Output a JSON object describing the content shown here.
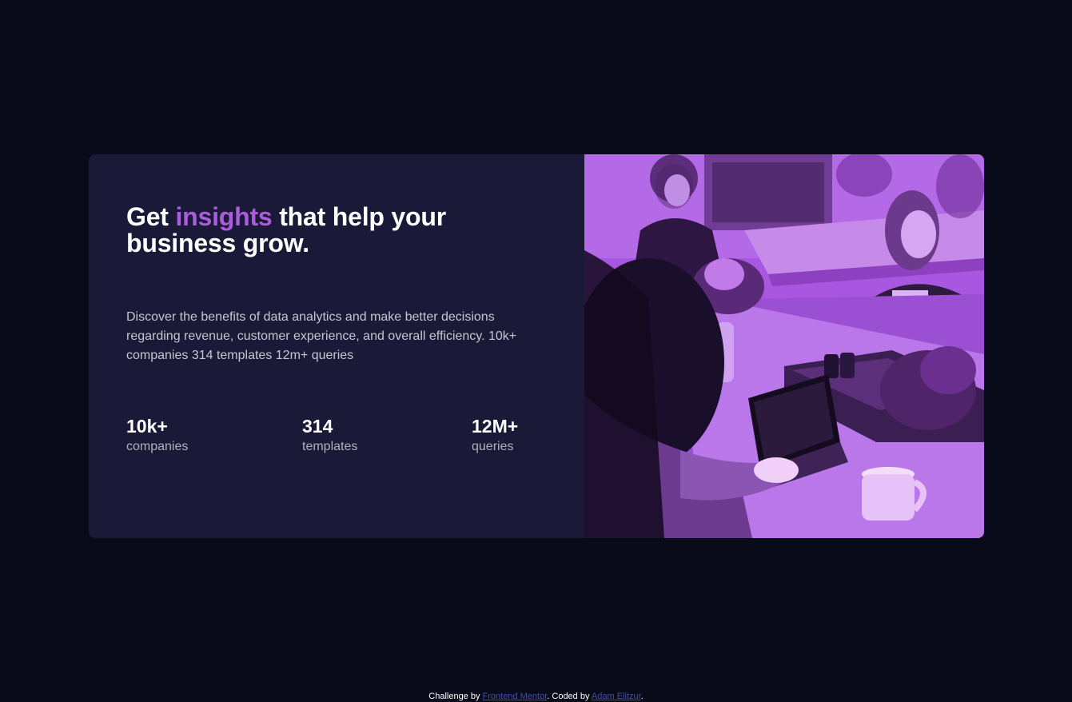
{
  "card": {
    "headline": {
      "before": "Get ",
      "highlight": "insights",
      "after": " that help your business grow."
    },
    "description": "Discover the benefits of data analytics and make better decisions regarding revenue, customer experience, and overall efficiency. 10k+ companies 314 templates 12m+ queries",
    "stats": [
      {
        "value": "10k+",
        "label": "companies"
      },
      {
        "value": "314",
        "label": "templates"
      },
      {
        "value": "12M+",
        "label": "queries"
      }
    ],
    "accent_color": "#aa5cdb",
    "card_background": "#1b1938",
    "photo_tint": "#a956e0"
  },
  "attribution": {
    "prefix": "Challenge by ",
    "challenge_link": "Frontend Mentor",
    "middle": ". Coded by ",
    "author_link": "Adam Elitzur",
    "suffix": "."
  },
  "page_background": "#090b1a"
}
